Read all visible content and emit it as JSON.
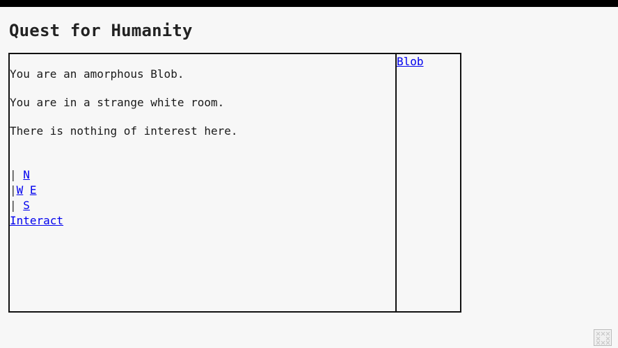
{
  "page": {
    "title": "Quest for Humanity"
  },
  "main": {
    "messages": [
      "You are an amorphous Blob.",
      "You are in a strange white room.",
      "There is nothing of interest here."
    ],
    "compass": {
      "bar": "|",
      "north": "N",
      "west": "W",
      "east": "E",
      "south": "S"
    },
    "interact_label": "Interact"
  },
  "side": {
    "character_link": "Blob"
  },
  "colors": {
    "link": "#0000ee",
    "border": "#111111",
    "background": "#f7f7f7"
  },
  "icons": {
    "corner": "grid-pattern-icon"
  }
}
